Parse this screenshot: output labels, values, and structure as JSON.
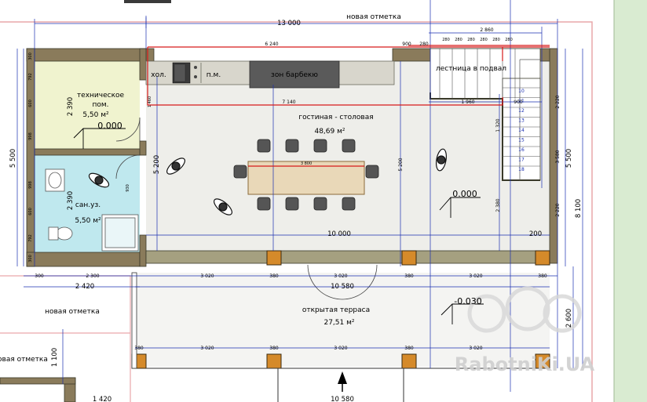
{
  "labels": {
    "top_ground_level": "новая отметка",
    "left_ground_level": "новая отметка",
    "bottom_ground_level": "новая отметка",
    "tech_room_line1": "техническое",
    "tech_room_line2": "пом.",
    "tech_room_area": "5,50 м²",
    "tech_room_level": "0.000",
    "bathroom_name": "сан.уз.",
    "bathroom_area": "5,50 м²",
    "fridge": "хол.",
    "counter": "п.м.",
    "bbq_zone": "зон барбекю",
    "stairs_to_basement": "лестница в подвал",
    "living_name": "гостиная - столовая",
    "living_area": "48,69 м²",
    "living_level": "0.000",
    "terrace_name": "открытая терраса",
    "terrace_area": "27,51 м²",
    "terrace_level": "-0.030",
    "watermark": "RabotniKi.UA"
  },
  "dimensions": {
    "total_width": "13 000",
    "right_width": "10 000",
    "left_width": "2 420",
    "terrace_width": "10 580",
    "terrace_width_bottom": "10 580",
    "left_bottom": "1 420",
    "total_depth_left": "5 500",
    "total_depth_right": "5 500",
    "full_depth": "8 100",
    "terrace_depth": "2 600",
    "offset_1100": "1 100",
    "tech_room_depth": "2 390",
    "bath_depth": "2 390",
    "living_depth": "5 200",
    "living_depth_2": "5 200",
    "kitchen_run": "6 240",
    "kitchen_inner": "7 140",
    "stair_run": "2 860",
    "stair_landing": "1 960",
    "stair_depth": "2 220",
    "stair_depth_2": "2 220",
    "stair_landing_depth": "1 320",
    "stair_flight": "2 380",
    "stair_flight_2": "3 580",
    "tech_inner_width": "2 300",
    "table_length": "3 800",
    "seg_3020_a": "3 020",
    "seg_3020_b": "3 020",
    "seg_3020_c": "3 020",
    "seg_3020_d": "3 020",
    "seg_3020_e": "3 020",
    "seg_3020_f": "3 020",
    "seg_380_a": "380",
    "seg_380_b": "380",
    "seg_380_c": "380",
    "seg_380_d": "380",
    "seg_380_e": "380",
    "seg_380_f": "380",
    "seg_900_a": "900",
    "seg_900_b": "900",
    "seg_280": "280",
    "seg_200": "200",
    "seg_300_a": "300",
    "seg_300_b": "300",
    "seg_300_c": "300",
    "seg_792_a": "792",
    "seg_792_b": "792",
    "seg_998_a": "998",
    "seg_998_b": "998",
    "seg_600_a": "600",
    "seg_600_b": "600",
    "seg_1460": "1 460",
    "seg_930": "930"
  },
  "stair_steps": [
    "10",
    "11",
    "12",
    "13",
    "14",
    "15",
    "16",
    "17",
    "18"
  ],
  "stair_treads": [
    "280",
    "280",
    "280",
    "280",
    "280",
    "280"
  ],
  "colors": {
    "wall": "#8a7b5b",
    "wall_edge": "#3a3a2a",
    "column": "#d58a2a",
    "tech_room_fill": "#f0f3cf",
    "bath_fill": "#bfe8ee",
    "floor_fill": "#eeeeea",
    "terrace_fill": "#f4f4f2",
    "table_fill": "#e9d8b8",
    "dim_line": "#1a2fb0",
    "red_line": "#d61a1a",
    "outline_pink": "#e9a7aa",
    "side_green": "#d9ebd1"
  }
}
